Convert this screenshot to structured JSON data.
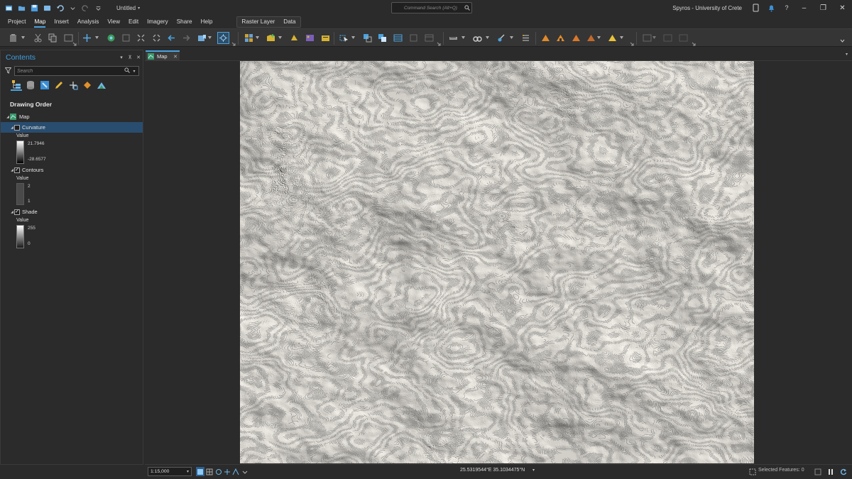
{
  "app": {
    "document_title": "Untitled",
    "user": "Spyros - University of Crete",
    "command_search_placeholder": "Command Search (Alt+Q)"
  },
  "colors": {
    "accent": "#4aa3df",
    "panel_bg": "#2b2b2b",
    "ribbon_bg": "#353535",
    "selected_row": "#294d6e",
    "contents_title": "#3e9ee0"
  },
  "menu": {
    "items": [
      "Project",
      "Map",
      "Insert",
      "Analysis",
      "View",
      "Edit",
      "Imagery",
      "Share",
      "Help"
    ],
    "active": "Map",
    "context_tabs": [
      "Raster Layer",
      "Data"
    ]
  },
  "contents": {
    "title": "Contents",
    "search_placeholder": "Search",
    "section_title": "Drawing Order",
    "map_label": "Map",
    "layers": [
      {
        "name": "Curvature",
        "checked": false,
        "selected": true,
        "legend_label": "Value",
        "max": "21.7946",
        "min": "-28.6577"
      },
      {
        "name": "Contours",
        "checked": true,
        "selected": false,
        "legend_label": "Value",
        "max": "2",
        "min": "1"
      },
      {
        "name": "Shade",
        "checked": true,
        "selected": false,
        "legend_label": "Value",
        "max": "255",
        "min": "0"
      }
    ]
  },
  "map_view": {
    "tab_label": "Map"
  },
  "status": {
    "scale": "1:15,000",
    "coordinates": "25.5319544°E 35.1034475°N",
    "selected_features": "Selected Features: 0"
  }
}
